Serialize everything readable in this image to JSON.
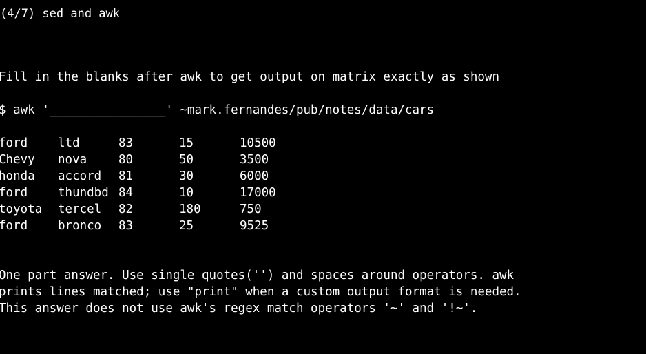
{
  "header": {
    "title": "(4/7) sed and awk"
  },
  "prompt": {
    "instruction": "Fill in the blanks after awk to get output on matrix exactly as shown",
    "command": "$ awk '________________' ~mark.fernandes/pub/notes/data/cars"
  },
  "output_rows": [
    [
      "ford",
      "ltd",
      "83",
      "15",
      "10500"
    ],
    [
      "Chevy",
      "nova",
      "80",
      "50",
      "3500"
    ],
    [
      "honda",
      "accord",
      "81",
      "30",
      "6000"
    ],
    [
      "ford",
      "thundbd",
      "84",
      "10",
      "17000"
    ],
    [
      "toyota",
      "tercel",
      "82",
      "180",
      "750"
    ],
    [
      "ford",
      "bronco",
      "83",
      "25",
      "9525"
    ]
  ],
  "hint": {
    "line1": "One part answer. Use single quotes('') and spaces around operators. awk",
    "line2": "prints lines matched; use \"print\" when a custom output format is needed.",
    "line3": "This answer does not use awk's regex match operators '~' and '!~'."
  },
  "colors": {
    "background": "#000000",
    "text": "#ffffff",
    "header_rule": "#4a8fd4"
  }
}
